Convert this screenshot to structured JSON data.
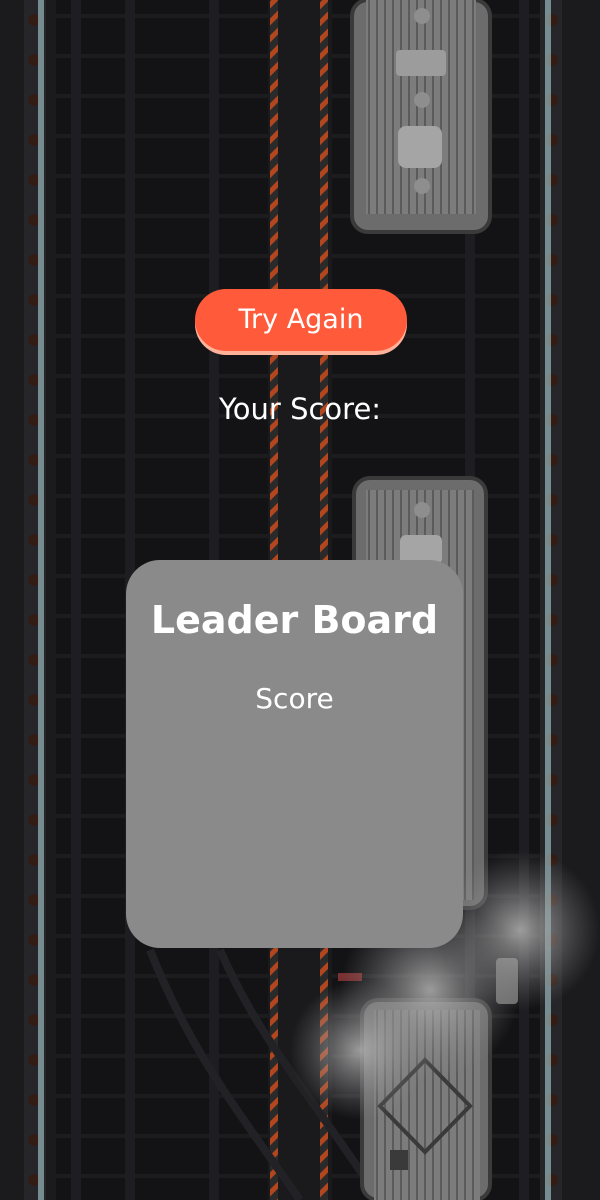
{
  "game": {
    "try_again_label": "Try Again",
    "your_score_label": "Your Score:",
    "leaderboard": {
      "title": "Leader Board",
      "column_header": "Score"
    }
  },
  "colors": {
    "button_bg": "#ff5a3a",
    "board_bg": "#8a8a8a",
    "background": "#0d0d10"
  }
}
